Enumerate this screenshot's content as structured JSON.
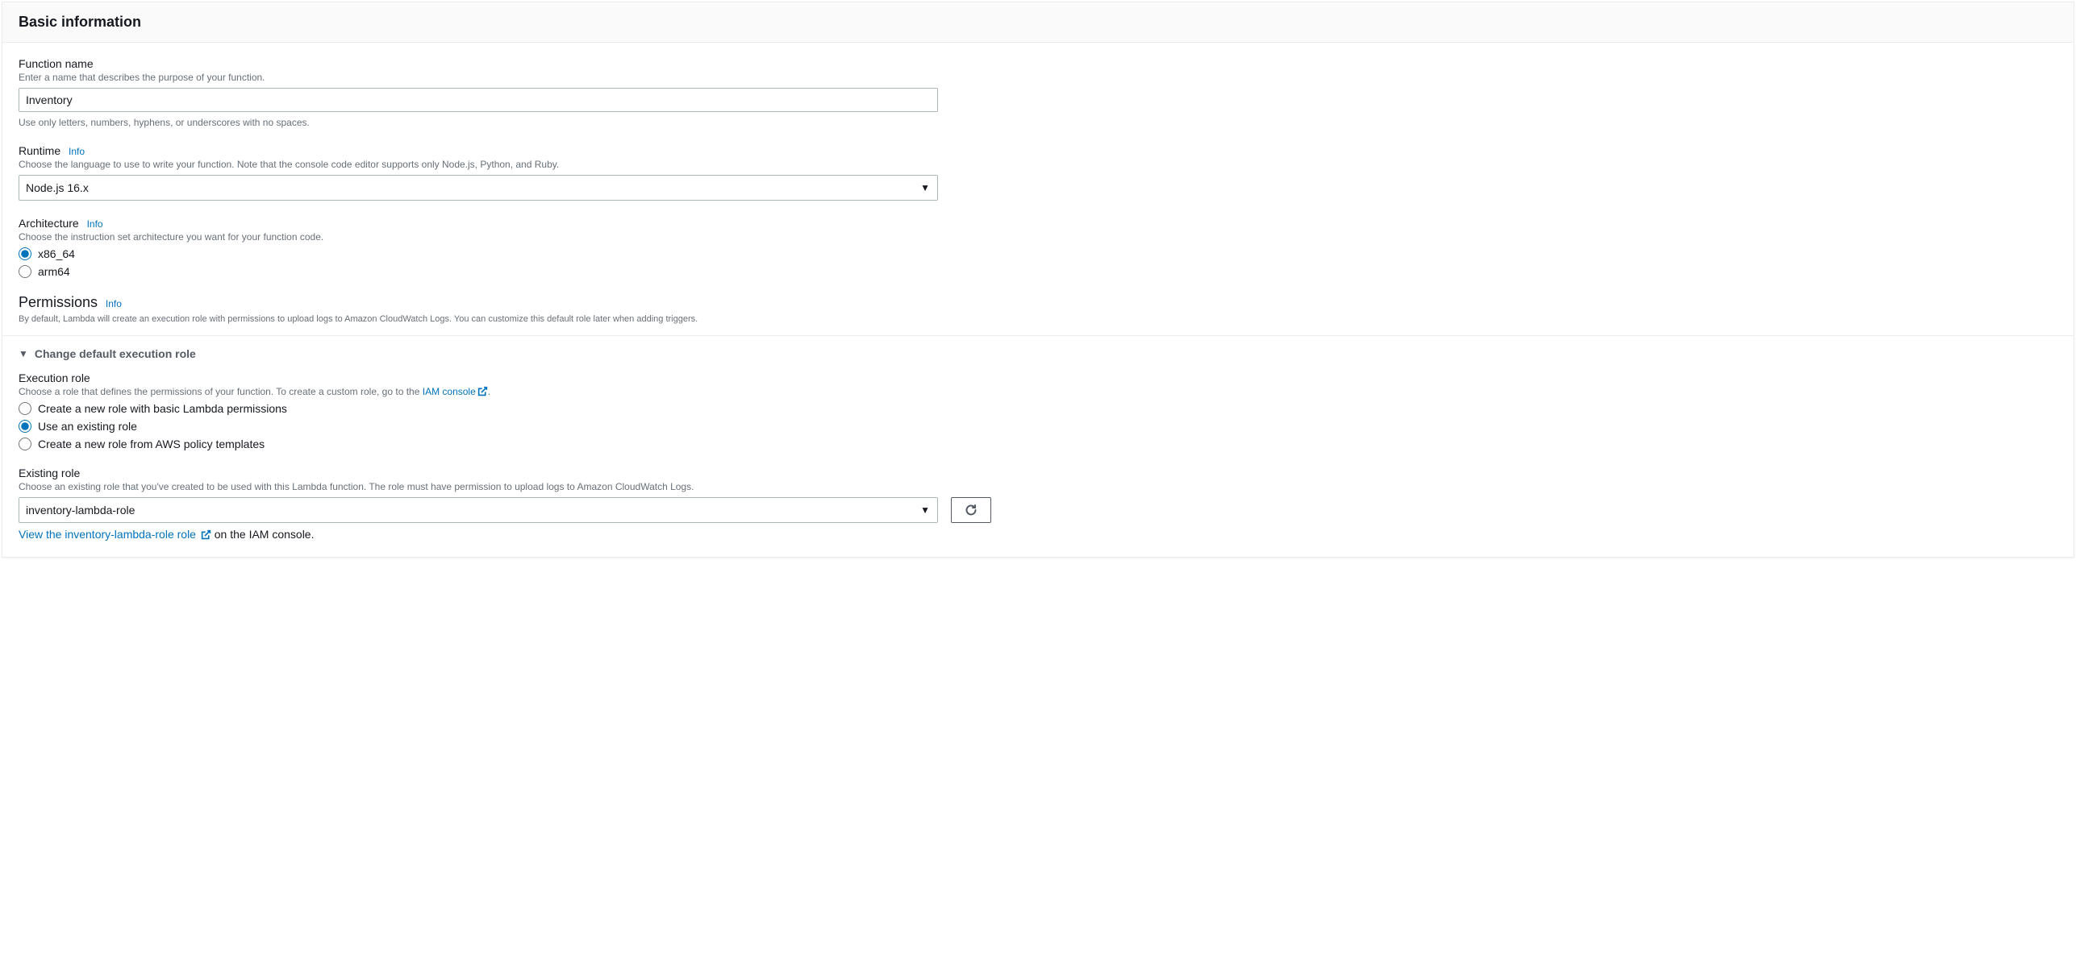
{
  "header": {
    "title": "Basic information"
  },
  "functionName": {
    "label": "Function name",
    "helper": "Enter a name that describes the purpose of your function.",
    "value": "Inventory",
    "constraint": "Use only letters, numbers, hyphens, or underscores with no spaces."
  },
  "runtime": {
    "label": "Runtime",
    "info": "Info",
    "helper": "Choose the language to use to write your function. Note that the console code editor supports only Node.js, Python, and Ruby.",
    "selected": "Node.js 16.x"
  },
  "architecture": {
    "label": "Architecture",
    "info": "Info",
    "helper": "Choose the instruction set architecture you want for your function code.",
    "options": [
      {
        "value": "x86_64",
        "label": "x86_64",
        "selected": true
      },
      {
        "value": "arm64",
        "label": "arm64",
        "selected": false
      }
    ]
  },
  "permissions": {
    "label": "Permissions",
    "info": "Info",
    "desc": "By default, Lambda will create an execution role with permissions to upload logs to Amazon CloudWatch Logs. You can customize this default role later when adding triggers."
  },
  "expander": {
    "label": "Change default execution role"
  },
  "executionRole": {
    "label": "Execution role",
    "helperPrefix": "Choose a role that defines the permissions of your function. To create a custom role, go to the ",
    "iamLink": "IAM console",
    "helperSuffix": ".",
    "options": [
      {
        "value": "new-basic",
        "label": "Create a new role with basic Lambda permissions",
        "selected": false
      },
      {
        "value": "existing",
        "label": "Use an existing role",
        "selected": true
      },
      {
        "value": "new-template",
        "label": "Create a new role from AWS policy templates",
        "selected": false
      }
    ]
  },
  "existingRole": {
    "label": "Existing role",
    "helper": "Choose an existing role that you've created to be used with this Lambda function. The role must have permission to upload logs to Amazon CloudWatch Logs.",
    "selected": "inventory-lambda-role",
    "viewLinkText": "View the inventory-lambda-role role",
    "viewSuffix": " on the IAM console."
  }
}
